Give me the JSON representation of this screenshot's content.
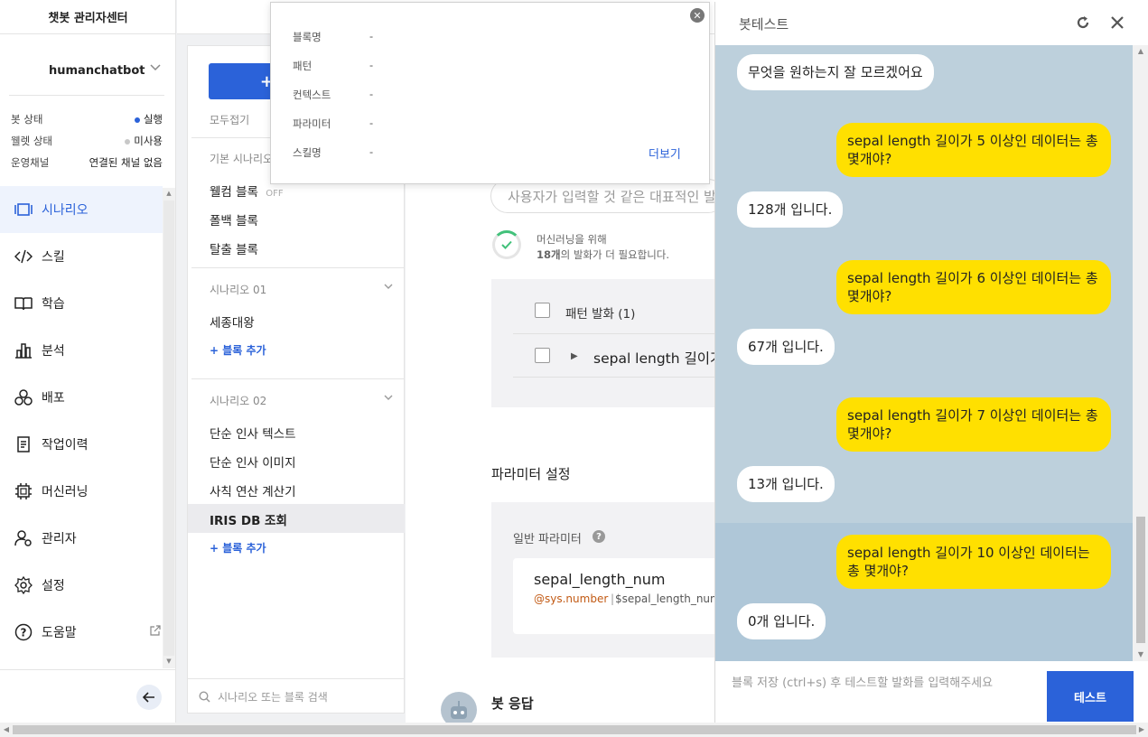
{
  "app": {
    "title": "챗봇 관리자센터"
  },
  "bot": {
    "name": "humanchatbot"
  },
  "status": [
    {
      "label": "봇 상태",
      "value": "실행",
      "dot": "#2b62d9"
    },
    {
      "label": "웰렛 상태",
      "value": "미사용",
      "dot": "#c8c8c8"
    },
    {
      "label": "운영채널",
      "value": "연결된 채널 없음"
    }
  ],
  "nav": [
    {
      "label": "시나리오",
      "icon": "scenario-icon",
      "active": true
    },
    {
      "label": "스킬",
      "icon": "code-icon"
    },
    {
      "label": "학습",
      "icon": "book-icon"
    },
    {
      "label": "분석",
      "icon": "chart-icon"
    },
    {
      "label": "배포",
      "icon": "deploy-icon"
    },
    {
      "label": "작업이력",
      "icon": "history-icon"
    },
    {
      "label": "머신러닝",
      "icon": "chip-icon"
    },
    {
      "label": "관리자",
      "icon": "admin-icon"
    },
    {
      "label": "설정",
      "icon": "gear-icon"
    },
    {
      "label": "도움말",
      "icon": "help-icon"
    }
  ],
  "scenario": {
    "add_label": "+",
    "collapse_all": "모두접기",
    "basic_label": "기본 시나리오",
    "basic_items": [
      {
        "label": "웰컴 블록",
        "badge": "OFF"
      },
      {
        "label": "폴백 블록"
      },
      {
        "label": "탈출 블록"
      }
    ],
    "groups": [
      {
        "title": "시나리오 01",
        "items": [
          "세종대왕"
        ],
        "add": "+ 블록 추가"
      },
      {
        "title": "시나리오 02",
        "items": [
          "단순 인사 텍스트",
          "단순 인사 이미지",
          "사칙 연산 계산기",
          "IRIS DB 조회"
        ],
        "add": "+ 블록 추가"
      }
    ],
    "search_placeholder": "시나리오 또는 블록 검색"
  },
  "popup": {
    "rows": [
      {
        "label": "블록명",
        "value": "-"
      },
      {
        "label": "패턴",
        "value": "-"
      },
      {
        "label": "컨텍스트",
        "value": "-"
      },
      {
        "label": "파라미터",
        "value": "-"
      },
      {
        "label": "스킬명",
        "value": "-"
      }
    ],
    "more": "더보기"
  },
  "main": {
    "utter_placeholder": "사용자가 입력할 것 같은 대표적인 발화",
    "ml_text1": "머신러닝을 위해",
    "ml_count": "18개",
    "ml_text2": "의 발화가 더 필요합니다.",
    "pattern_header": "패턴 발화 (1)",
    "pattern_row": "sepal length 길이가",
    "param_title": "파라미터 설정",
    "param_label": "일반 파라미터",
    "param_name": "sepal_length_num",
    "param_type": "@sys.number",
    "param_var": "$sepal_length_num",
    "bot_response": "봇 응답"
  },
  "bottest": {
    "title": "봇테스트",
    "messages": [
      {
        "from": "bot",
        "text": "무엇을 원하는지 잘 모르겠어요"
      },
      {
        "from": "user",
        "text": "sepal length 길이가 5 이상인 데이터는 총 몇개야?"
      },
      {
        "from": "bot",
        "text": "128개 입니다."
      },
      {
        "from": "user",
        "text": "sepal length 길이가 6 이상인 데이터는 총 몇개야?"
      },
      {
        "from": "bot",
        "text": "67개 입니다."
      },
      {
        "from": "user",
        "text": "sepal length 길이가 7 이상인 데이터는 총 몇개야?"
      },
      {
        "from": "bot",
        "text": "13개 입니다."
      },
      {
        "from": "user",
        "text": "sepal length 길이가 10 이상인 데이터는 총 몇개야?"
      },
      {
        "from": "bot",
        "text": "0개 입니다."
      }
    ],
    "input_placeholder": "블록 저장 (ctrl+s) 후 테스트할 발화를 입력해주세요",
    "send_label": "테스트"
  },
  "colors": {
    "accent": "#2b62d9",
    "user_bubble": "#ffe000",
    "chat_bg": "#bdd0dc"
  }
}
